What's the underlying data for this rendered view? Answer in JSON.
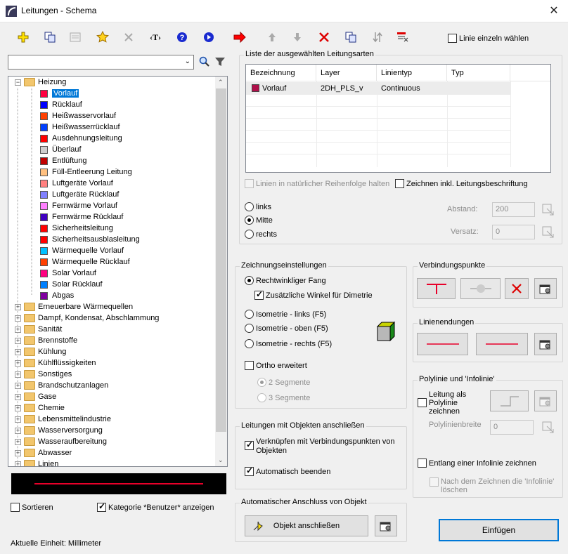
{
  "window": {
    "title": "Leitungen - Schema",
    "close": "✕"
  },
  "toolbar": {
    "linie_einzeln": "Linie einzeln wählen"
  },
  "tree": {
    "root": "Heizung",
    "children": [
      {
        "label": "Vorlauf",
        "color": "#ff0040"
      },
      {
        "label": "Rücklauf",
        "color": "#0000ff"
      },
      {
        "label": "Heißwasservorlauf",
        "color": "#ff4000"
      },
      {
        "label": "Heißwasserrücklauf",
        "color": "#0040ff"
      },
      {
        "label": "Ausdehnungsleitung",
        "color": "#ff0000"
      },
      {
        "label": "Überlauf",
        "color": "#cfcfcf"
      },
      {
        "label": "Entlüftung",
        "color": "#c00000"
      },
      {
        "label": "Füll-Entleerung Leitung",
        "color": "#ffc080"
      },
      {
        "label": "Luftgeräte Vorlauf",
        "color": "#ff8080"
      },
      {
        "label": "Luftgeräte Rücklauf",
        "color": "#8080ff"
      },
      {
        "label": "Fernwärme Vorlauf",
        "color": "#ff80ff"
      },
      {
        "label": "Fernwärme Rücklauf",
        "color": "#4000c0"
      },
      {
        "label": "Sicherheitsleitung",
        "color": "#ff0000"
      },
      {
        "label": "Sicherheitsausblasleitung",
        "color": "#ff0000"
      },
      {
        "label": "Wärmequelle Vorlauf",
        "color": "#00c0ff"
      },
      {
        "label": "Wärmequelle Rücklauf",
        "color": "#ff4000"
      },
      {
        "label": "Solar Vorlauf",
        "color": "#ff0080"
      },
      {
        "label": "Solar Rücklauf",
        "color": "#0080ff"
      },
      {
        "label": "Abgas",
        "color": "#8000a0"
      }
    ],
    "folders": [
      "Erneuerbare Wärmequellen",
      "Dampf, Kondensat, Abschlammung",
      "Sanität",
      "Brennstoffe",
      "Kühlung",
      "Kühlflüssigkeiten",
      "Sonstiges",
      "Brandschutzanlagen",
      "Gase",
      "Chemie",
      "Lebensmittelindustrie",
      "Wasserversorgung",
      "Wasseraufbereitung",
      "Abwasser",
      "Linien"
    ]
  },
  "left_bottom": {
    "sortieren": "Sortieren",
    "kategorie": "Kategorie *Benutzer* anzeigen",
    "einheit": "Aktuelle Einheit: Millimeter"
  },
  "liste": {
    "title": "Liste der ausgewählten Leitungsarten",
    "headers": [
      "Bezeichnung",
      "Layer",
      "Linientyp",
      "Typ"
    ],
    "row": {
      "name": "Vorlauf",
      "layer": "2DH_PLS_v",
      "linientyp": "Continuous",
      "typ": "",
      "color": "#b0104a"
    },
    "natuerlich": "Linien in natürlicher Reihenfolge halten",
    "inkl": "Zeichnen inkl. Leitungsbeschriftung",
    "links": "links",
    "mitte": "Mitte",
    "rechts": "rechts",
    "abstand_label": "Abstand:",
    "abstand": "200",
    "versatz_label": "Versatz:",
    "versatz": "0"
  },
  "zeichnung": {
    "title": "Zeichnungseinstellungen",
    "rechtwinklig": "Rechtwinkliger Fang",
    "zusatz": "Zusätzliche Winkel für Dimetrie",
    "iso_links": "Isometrie - links (F5)",
    "iso_oben": "Isometrie - oben (F5)",
    "iso_rechts": "Isometrie - rechts (F5)",
    "ortho": "Ortho erweitert",
    "seg2": "2 Segmente",
    "seg3": "3 Segmente"
  },
  "objekte": {
    "title": "Leitungen mit Objekten anschließen",
    "verknuepfen": "Verknüpfen mit Verbindungspunkten von Objekten",
    "auto": "Automatisch beenden"
  },
  "anschluss": {
    "title": "Automatischer Anschluss von Objekt",
    "button": "Objekt anschließen"
  },
  "verbindung": {
    "title": "Verbindungspunkte"
  },
  "linienenden": {
    "title": "Linienendungen"
  },
  "polylinie": {
    "title": "Polylinie und 'Infolinie'",
    "als_poly": "Leitung als Polylinie zeichnen",
    "breite_label": "Polylinienbreite",
    "breite": "0",
    "infolinie": "Entlang einer Infolinie zeichnen",
    "loeschen": "Nach dem Zeichnen die 'Infolinie' löschen"
  },
  "einfuegen": "Einfügen",
  "colors": {
    "accent": "#0078d7",
    "line_red": "#e8002a"
  }
}
